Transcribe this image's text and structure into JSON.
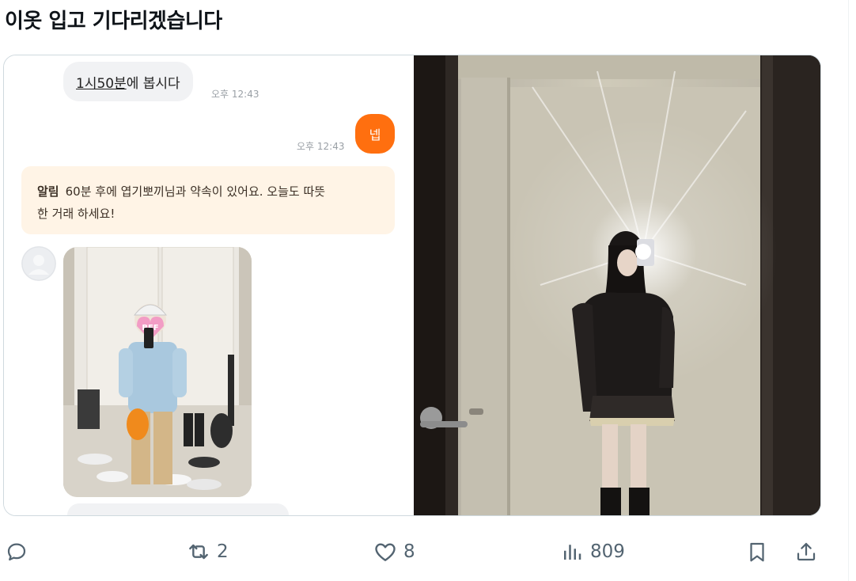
{
  "tweet": {
    "text": "이옷 입고 기다리겠습니다"
  },
  "chat": {
    "incoming": {
      "link_text": "1시50분",
      "rest_text": "에 봅시다",
      "time": "오후 12:43"
    },
    "outgoing": {
      "text": "넵",
      "time": "오후 12:43"
    },
    "notice": {
      "label": "알림",
      "line1": "60분 후에 엽기뽀끼님과 약속이 있어요. 오늘도 따뜻",
      "line2": "한 거래 하세요!"
    },
    "sticker_text": "BFF"
  },
  "actions": {
    "reply": {
      "icon": "reply-icon"
    },
    "repost": {
      "icon": "repost-icon",
      "count": "2"
    },
    "like": {
      "icon": "heart-icon",
      "count": "8"
    },
    "views": {
      "icon": "views-icon",
      "count": "809"
    },
    "bookmark": {
      "icon": "bookmark-icon"
    },
    "share": {
      "icon": "share-icon"
    }
  },
  "colors": {
    "accent_orange": "#ff6f0f",
    "notice_bg": "#fff4e6",
    "action_gray": "#536471"
  }
}
